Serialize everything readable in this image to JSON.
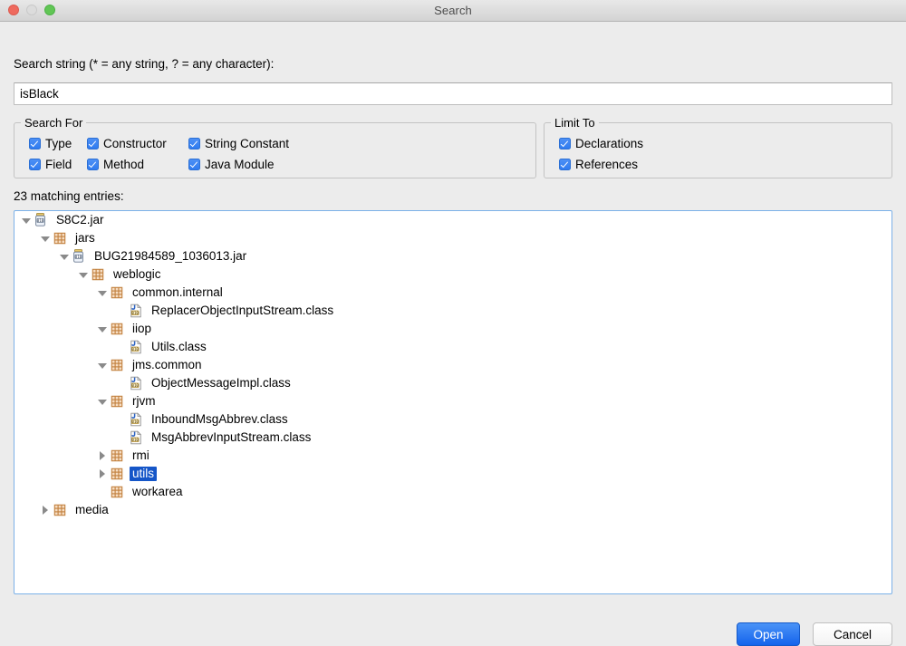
{
  "window": {
    "title": "Search",
    "controls": [
      {
        "name": "close-button",
        "color": "#ef6a5e"
      },
      {
        "name": "minimize-button",
        "color": "#dcdcdc"
      },
      {
        "name": "maximize-button",
        "color": "#61c655"
      }
    ]
  },
  "search": {
    "label": "Search string (* = any string, ? = any character):",
    "value": "isBlack",
    "placeholder": ""
  },
  "search_for": {
    "legend": "Search For",
    "items": [
      {
        "label": "Type",
        "checked": true
      },
      {
        "label": "Constructor",
        "checked": true
      },
      {
        "label": "String Constant",
        "checked": true
      },
      {
        "label": "Field",
        "checked": true
      },
      {
        "label": "Method",
        "checked": true
      },
      {
        "label": "Java Module",
        "checked": true
      }
    ]
  },
  "limit_to": {
    "legend": "Limit To",
    "items": [
      {
        "label": "Declarations",
        "checked": true
      },
      {
        "label": "References",
        "checked": true
      }
    ]
  },
  "results": {
    "count_label": "23 matching entries:",
    "rows": [
      {
        "label": "S8C2.jar",
        "depth": 0,
        "twisty": "down",
        "icon": "jar-icon",
        "selected": false
      },
      {
        "label": "jars",
        "depth": 1,
        "twisty": "down",
        "icon": "package-icon",
        "selected": false
      },
      {
        "label": "BUG21984589_1036013.jar",
        "depth": 2,
        "twisty": "down",
        "icon": "jar-icon",
        "selected": false
      },
      {
        "label": "weblogic",
        "depth": 3,
        "twisty": "down",
        "icon": "package-icon",
        "selected": false
      },
      {
        "label": "common.internal",
        "depth": 4,
        "twisty": "down",
        "icon": "package-icon",
        "selected": false
      },
      {
        "label": "ReplacerObjectInputStream.class",
        "depth": 5,
        "twisty": "none",
        "icon": "class-icon",
        "selected": false
      },
      {
        "label": "iiop",
        "depth": 4,
        "twisty": "down",
        "icon": "package-icon",
        "selected": false
      },
      {
        "label": "Utils.class",
        "depth": 5,
        "twisty": "none",
        "icon": "class-icon",
        "selected": false
      },
      {
        "label": "jms.common",
        "depth": 4,
        "twisty": "down",
        "icon": "package-icon",
        "selected": false
      },
      {
        "label": "ObjectMessageImpl.class",
        "depth": 5,
        "twisty": "none",
        "icon": "class-icon",
        "selected": false
      },
      {
        "label": "rjvm",
        "depth": 4,
        "twisty": "down",
        "icon": "package-icon",
        "selected": false
      },
      {
        "label": "InboundMsgAbbrev.class",
        "depth": 5,
        "twisty": "none",
        "icon": "class-icon",
        "selected": false
      },
      {
        "label": "MsgAbbrevInputStream.class",
        "depth": 5,
        "twisty": "none",
        "icon": "class-icon",
        "selected": false
      },
      {
        "label": "rmi",
        "depth": 4,
        "twisty": "right",
        "icon": "package-icon",
        "selected": false
      },
      {
        "label": "utils",
        "depth": 4,
        "twisty": "right",
        "icon": "package-icon",
        "selected": true
      },
      {
        "label": "workarea",
        "depth": 4,
        "twisty": "none",
        "icon": "package-icon",
        "selected": false
      },
      {
        "label": "media",
        "depth": 1,
        "twisty": "right",
        "icon": "package-icon",
        "selected": false
      }
    ]
  },
  "buttons": {
    "open": "Open",
    "cancel": "Cancel"
  },
  "colors": {
    "accent": "#1463ec",
    "selection": "#1556c8",
    "checkbox": "#2f7bf0",
    "panel_border": "#7bb1e8",
    "window_bg": "#ececec"
  }
}
